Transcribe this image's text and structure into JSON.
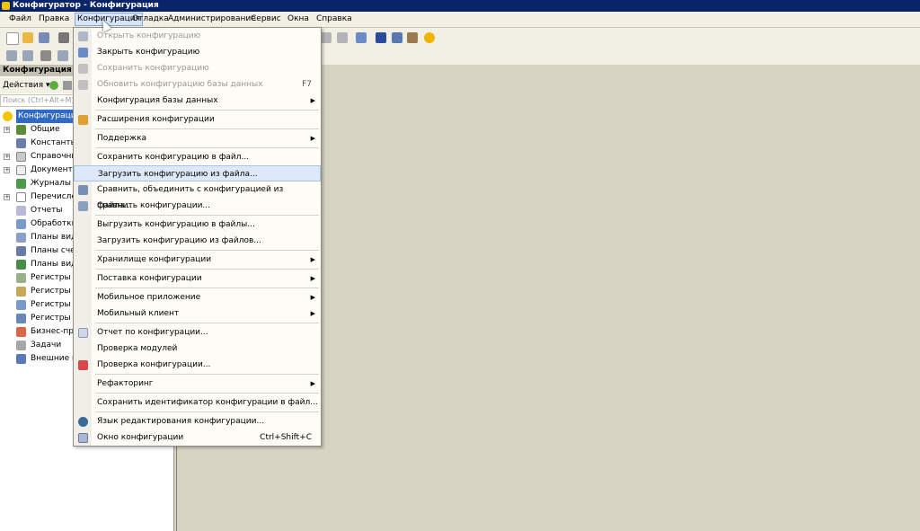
{
  "window": {
    "title": "Конфигуратор - Конфигурация"
  },
  "menubar": {
    "items": [
      "Файл",
      "Правка",
      "Конфигурация",
      "Отладка",
      "Администрирование",
      "Сервис",
      "Окна",
      "Справка"
    ]
  },
  "panel": {
    "header": "Конфигурация",
    "actions_label": "Действия ▾",
    "search_placeholder": "Поиск (Ctrl+Alt+M)",
    "tree": [
      "Конфигурация",
      "Общие",
      "Константы",
      "Справочник",
      "Документы",
      "Журналы до",
      "Перечислен",
      "Отчеты",
      "Обработки",
      "Планы видо",
      "Планы счет",
      "Планы видо",
      "Регистры св",
      "Регистры н",
      "Регистры бу",
      "Регистры ра",
      "Бизнес-про",
      "Задачи",
      "Внешние ис"
    ]
  },
  "dropdown": {
    "items": [
      {
        "label": "Открыть конфигурацию",
        "disabled": true
      },
      {
        "label": "Закрыть конфигурацию"
      },
      {
        "label": "Сохранить конфигурацию",
        "disabled": true
      },
      {
        "label": "Обновить конфигурацию базы данных",
        "shortcut": "F7",
        "disabled": true
      },
      {
        "label": "Конфигурация базы данных",
        "submenu": true
      },
      {
        "label": "Расширения конфигурации"
      },
      {
        "label": "Поддержка",
        "submenu": true
      },
      {
        "label": "Сохранить конфигурацию в файл..."
      },
      {
        "label": "Загрузить конфигурацию из файла...",
        "highlighted": true
      },
      {
        "label": "Сравнить, объединить с конфигурацией из файла..."
      },
      {
        "label": "Сравнить конфигурации..."
      },
      {
        "label": "Выгрузить конфигурацию в файлы..."
      },
      {
        "label": "Загрузить конфигурацию из файлов..."
      },
      {
        "label": "Хранилище конфигурации",
        "submenu": true
      },
      {
        "label": "Поставка конфигурации",
        "submenu": true
      },
      {
        "label": "Мобильное приложение",
        "submenu": true
      },
      {
        "label": "Мобильный клиент",
        "submenu": true
      },
      {
        "label": "Отчет по конфигурации..."
      },
      {
        "label": "Проверка модулей"
      },
      {
        "label": "Проверка конфигурации..."
      },
      {
        "label": "Рефакторинг",
        "submenu": true
      },
      {
        "label": "Сохранить идентификатор конфигурации в файл..."
      },
      {
        "label": "Язык редактирования конфигурации..."
      },
      {
        "label": "Окно конфигурации",
        "shortcut": "Ctrl+Shift+C"
      }
    ]
  },
  "colors": {
    "titlebar": "#0a246a",
    "selection": "#3169c6",
    "menu_highlight": "#dde8f8"
  }
}
